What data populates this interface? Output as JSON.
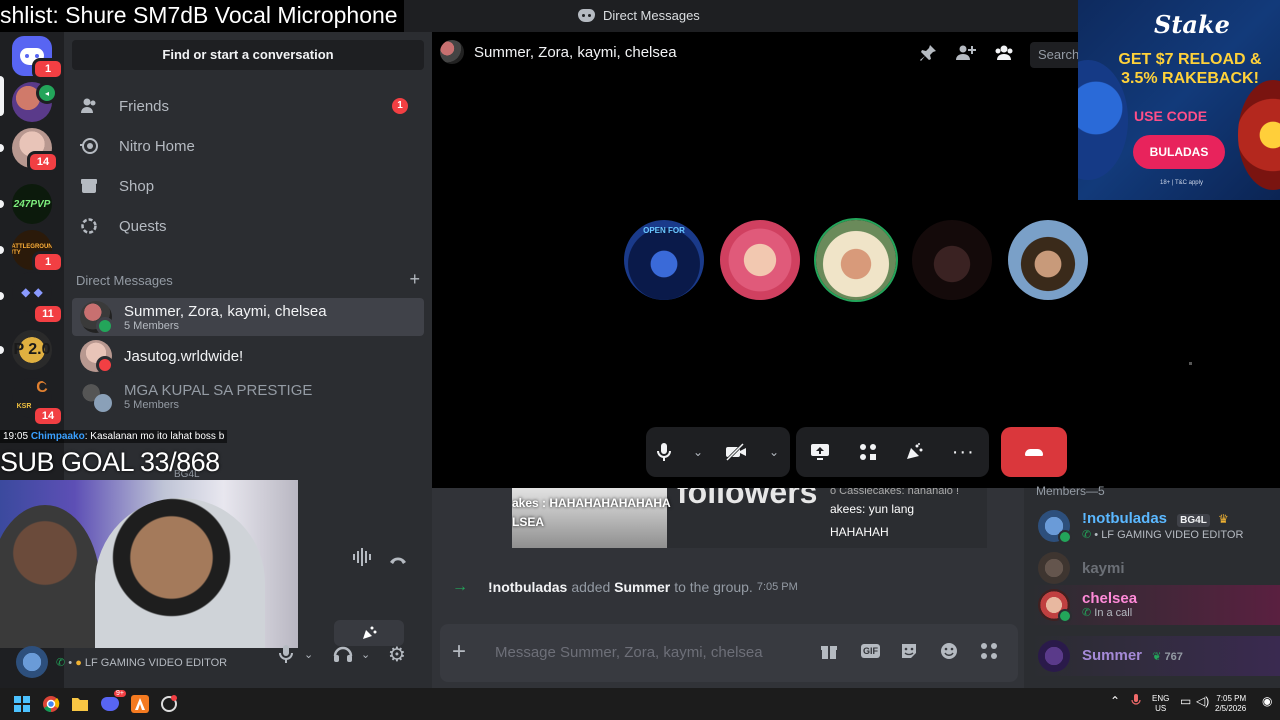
{
  "stream_overlay": {
    "title_fragment": "shlist: Shure SM7dB Vocal Microphone",
    "chat_time": "19:05",
    "chat_user": "Chimpaako",
    "chat_message": "Kasalanan mo ito lahat boss b",
    "sub_goal": "SUB GOAL 33/868"
  },
  "window": {
    "title": "Direct Messages"
  },
  "servers": {
    "badges": [
      "1",
      "14",
      "1",
      "11",
      "14"
    ],
    "labels": [
      "247PVP",
      "BATTLEGROUND CITY",
      "P 2.0",
      "C",
      "KSR"
    ]
  },
  "sidebar": {
    "search": "Find or start a conversation",
    "nav": [
      {
        "label": "Friends",
        "icon": "friends-icon",
        "badge": "1"
      },
      {
        "label": "Nitro Home",
        "icon": "nitro-icon"
      },
      {
        "label": "Shop",
        "icon": "shop-icon"
      },
      {
        "label": "Quests",
        "icon": "quests-icon"
      }
    ],
    "dm_header": "Direct Messages",
    "dms": [
      {
        "name": "Summer, Zora, kaymi, chelsea",
        "sub": "5 Members"
      },
      {
        "name": "Jasutog.wrldwide!",
        "sub": ""
      },
      {
        "name": "MGA KUPAL SA PRESTIGE",
        "sub": "5 Members"
      }
    ],
    "partial_dm_tag": "BG4L"
  },
  "userbar": {
    "status": "LF GAMING VIDEO EDITOR"
  },
  "call": {
    "header_title": "Summer, Zora, kaymi, chelsea",
    "search_placeholder": "Search",
    "participants_count": 5
  },
  "ad": {
    "brand": "Stake",
    "headline": "GET $7 RELOAD & 3.5% RAKEBACK!",
    "use_code": "USE CODE",
    "code": "BULADAS",
    "fine_print": "18+ | T&C apply"
  },
  "chat": {
    "embed": {
      "line1": "akes : HAHAHAHAHAHAHA",
      "line2": "LSEA",
      "big_text": "followers",
      "right1": "o Cassiecakes: hahahaio !",
      "right2": "akees: yun lang",
      "right3": "HAHAHAH"
    },
    "system": {
      "actor": "!notbuladas",
      "action": "added",
      "target": "Summer",
      "suffix": "to the group.",
      "time": "7:05 PM"
    },
    "composer_placeholder": "Message Summer, Zora, kaymi, chelsea",
    "gif_label": "GIF"
  },
  "members": {
    "header": "Members—5",
    "list": [
      {
        "name": "!notbuladas",
        "tag": "BG4L",
        "sub": "LF GAMING VIDEO EDITOR",
        "color": "#5bb8ff"
      },
      {
        "name": "kaymi",
        "sub": "",
        "color": "#6b6f76"
      },
      {
        "name": "chelsea",
        "sub": "In a call",
        "color": "#ff8ad8"
      },
      {
        "name": "Summer",
        "pts": "767",
        "sub": "",
        "color": "#a58ad8"
      }
    ]
  },
  "taskbar": {
    "lang1": "ENG",
    "lang2": "US",
    "time": "7:05 PM",
    "date": "2/5/2026",
    "discord_badge": "9+"
  }
}
